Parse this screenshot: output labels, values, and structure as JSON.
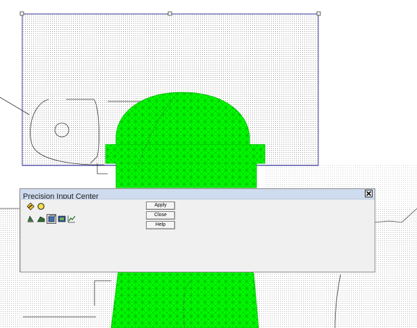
{
  "dialog": {
    "title": "Precision Input Center",
    "buttons": {
      "apply": "Apply",
      "close": "Close",
      "help": "Help"
    },
    "snap_tools": [
      {
        "icon": "snap-point-icon"
      },
      {
        "icon": "snap-circle-icon"
      }
    ],
    "input_tools": [
      {
        "icon": "tool-cone-icon"
      },
      {
        "icon": "tool-wedge-icon"
      },
      {
        "icon": "tool-box-icon"
      },
      {
        "icon": "tool-screen-icon"
      },
      {
        "icon": "tool-graph-icon"
      }
    ]
  },
  "colors": {
    "wireframe_green": "#00ff00",
    "selection_blue": "#3a3aa0",
    "grid_dots": "#9a9a9a",
    "dialog_bg": "#f0f0f0",
    "titlebar": "#cfdcef"
  }
}
